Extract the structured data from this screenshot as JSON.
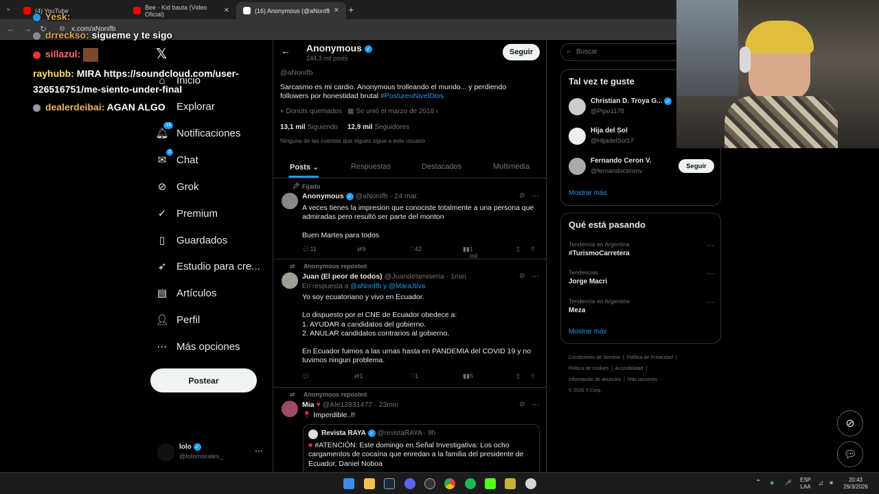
{
  "browser": {
    "tabs": [
      {
        "label": "(4) YouTube",
        "fav": "#ff0000"
      },
      {
        "label": "Bee - Kid bauta (Video Oficial)",
        "fav": "#ff0000"
      },
      {
        "label": "(16) Anonymous (@aNonIfb) / X",
        "fav": "#ffffff"
      }
    ],
    "url": "x.com/aNonIfb"
  },
  "chat_overlay": [
    {
      "user": "Yesk:",
      "text": ""
    },
    {
      "user": "drreckso:",
      "text": "sigueme y te sigo"
    },
    {
      "user": "sillazul:",
      "text": ""
    },
    {
      "user": "rayhubb:",
      "text": "MIRA https://soundcloud.com/user-"
    },
    {
      "user": "",
      "text": "326516751/me-siento-under-final"
    },
    {
      "user": "dealerdeibai:",
      "text": "AGAN ALGO"
    }
  ],
  "nav": {
    "items": [
      {
        "label": "Inicio",
        "icon": "home-icon"
      },
      {
        "label": "Explorar",
        "icon": "search-icon"
      },
      {
        "label": "Notificaciones",
        "icon": "bell-icon",
        "badge": "14"
      },
      {
        "label": "Chat",
        "icon": "mail-icon",
        "badge": "2"
      },
      {
        "label": "Grok",
        "icon": "grok-icon"
      },
      {
        "label": "Premium",
        "icon": "premium-icon"
      },
      {
        "label": "Guardados",
        "icon": "bookmark-icon"
      },
      {
        "label": "Estudio para cre...",
        "icon": "rocket-icon"
      },
      {
        "label": "Artículos",
        "icon": "article-icon"
      },
      {
        "label": "Perfil",
        "icon": "person-icon"
      },
      {
        "label": "Más opciones",
        "icon": "more-icon"
      }
    ],
    "post_button": "Postear",
    "account": {
      "name": "lolo",
      "handle": "@lolomorales_"
    }
  },
  "profile": {
    "name": "Anonymous",
    "posts_count": "244,3 mil posts",
    "handle": "@aNonIfb",
    "bio": "Sarcasmo es mi cardio. Anonymous trolleando el mundo... y perdiendo followers por honestidad brutal",
    "bio_hashtag": "#PostureoNivelDios",
    "location": "Donuts quemados",
    "joined": "Se unió el marzo de 2018",
    "following_count": "13,1 mil",
    "following_label": "Siguiendo",
    "followers_count": "12,9 mil",
    "followers_label": "Seguidores",
    "mutuals_note": "Ninguna de las cuentas que sigues sigue a este usuario",
    "follow_button": "Seguir"
  },
  "profile_tabs": [
    "Posts",
    "Respuestas",
    "Destacados",
    "Multimedia"
  ],
  "tweets": [
    {
      "context": "Fijado",
      "name": "Anonymous",
      "handle": "@aNonIfb",
      "time": "· 24 mar.",
      "text1": "A veces tienes la impresion que conociste totalmente a una persona que admiradas pero resultó ser parte del monton",
      "text2": "Buen Martes para todos",
      "replies": "11",
      "reposts": "9",
      "likes": "42",
      "views": "1 mil"
    },
    {
      "context": "Anonymous reposteó",
      "name": "Juan (El peor de todos)",
      "handle": "@Juandelamiseria",
      "time": "· 1min",
      "reply_prefix": "En respuesta a",
      "reply_to": "@aNonIfb y @MaraJtiva",
      "text1": "Yo soy ecuatoriano y vivo en Ecuador.",
      "text2": "Lo dispuesto por el CNE de Ecuador obedece a:",
      "text3": "1. AYUDAR a candidatos del gobierno.",
      "text4": "2. ANULAR candidatos contrarios al gobierno.",
      "text5": "En Ecuador fuimos a las urnas hasta en PANDEMIA del COVID 19 y no tuvimos ningun problema.",
      "replies": "",
      "reposts": "1",
      "likes": "1",
      "views": "6"
    },
    {
      "context": "Anonymous reposteó",
      "name": "Mia",
      "handle": "@Ale12831477",
      "time": "· 23min",
      "text1": "Imperdible..!!",
      "quote_name": "Revista RAYA",
      "quote_handle": "@revistaRAYA",
      "quote_time": "· 9h",
      "quote_text": "#ATENCIÓN: Este domingo en Señal Investigativa: Los ocho cargamentos de cocaína que enredan a la familia del presidente de Ecuador, Daniel Noboa"
    }
  ],
  "right": {
    "search_placeholder": "Buscar",
    "suggest_title": "Tal vez te guste",
    "suggestions": [
      {
        "name": "Christian D. Troya G...",
        "handle": "@Pipo1178"
      },
      {
        "name": "Hija del Sol",
        "handle": "@HijadelSol17"
      },
      {
        "name": "Fernando Ceron V.",
        "handle": "@fernandoceronv",
        "button": "Seguir"
      }
    ],
    "show_more": "Mostrar más",
    "trends_title": "Qué está pasando",
    "trends": [
      {
        "context": "Tendencia en Argentina",
        "title": "#TurismoCarretera"
      },
      {
        "context": "Tendencias",
        "title": "Jorge Macri"
      },
      {
        "context": "Tendencia en Argentina",
        "title": "Meza"
      }
    ],
    "footer": [
      "Condiciones de Servicio",
      "Política de Privacidad",
      "Política de cookies",
      "Accesibilidad",
      "Información de anuncios",
      "Más opciones ···",
      "© 2026 X Corp."
    ]
  },
  "taskbar": {
    "lang1": "ESP",
    "lang2": "LAA",
    "time": "20:43",
    "date": "29/3/2026"
  }
}
